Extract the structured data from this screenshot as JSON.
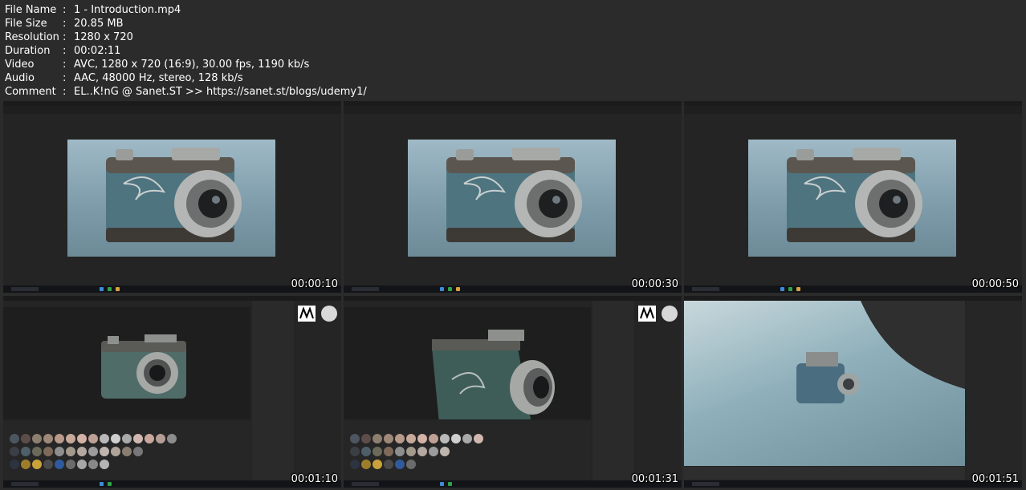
{
  "file_info": [
    {
      "key": "File Name",
      "sep": ":",
      "value": "1 - Introduction.mp4"
    },
    {
      "key": "File Size",
      "sep": ":",
      "value": "20.85 MB"
    },
    {
      "key": "Resolution",
      "sep": ":",
      "value": "1280 x 720"
    },
    {
      "key": "Duration",
      "sep": ":",
      "value": "00:02:11"
    },
    {
      "key": "Video",
      "sep": ":",
      "value": "AVC, 1280 x 720 (16:9), 30.00 fps, 1190 kb/s"
    },
    {
      "key": "Audio",
      "sep": ":",
      "value": "AAC, 48000 Hz, stereo, 128 kb/s"
    },
    {
      "key": "Comment",
      "sep": ":",
      "value": "EL..K!nG @ Sanet.ST >> https://sanet.st/blogs/udemy1/"
    }
  ],
  "thumbnails": [
    {
      "timestamp": "00:00:10",
      "scene": "camera-render-viewer"
    },
    {
      "timestamp": "00:00:30",
      "scene": "camera-render-viewer"
    },
    {
      "timestamp": "00:00:50",
      "scene": "camera-render-viewer"
    },
    {
      "timestamp": "00:01:10",
      "scene": "substance-painter"
    },
    {
      "timestamp": "00:01:31",
      "scene": "substance-painter"
    },
    {
      "timestamp": "00:01:51",
      "scene": "blender"
    }
  ],
  "colors": {
    "page_bg": "#2b2b2b",
    "render_bg": "#8eaab6",
    "camera_body": "#4e7480",
    "camera_metal": "#a9acab",
    "taskbar": "#121418"
  }
}
